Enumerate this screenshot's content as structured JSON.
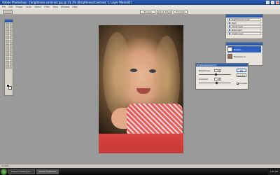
{
  "titlebar": {
    "title": "Adobe Photoshop - [brightness contrast.jpg @ 33.3% (Brightness/Contrast 1, Layer Mask/8)]"
  },
  "menu": [
    "File",
    "Edit",
    "Image",
    "Layer",
    "Select",
    "Filter",
    "View",
    "Window",
    "Help"
  ],
  "options": {
    "btn1": "Window",
    "btn2": "Actual Pixels",
    "btn3": "Print Size"
  },
  "history_panel": {
    "rows": [
      "Brightness/Contrast",
      "Open",
      "Adjust Layer",
      "Make Layer",
      "Create Layer",
      "Create Lay"
    ]
  },
  "layers_panel": {
    "rows": [
      {
        "label": "Brightn...",
        "selected": true
      },
      {
        "label": "Background",
        "selected": false
      }
    ]
  },
  "dialog": {
    "title": "Brightness/Contrast",
    "brightness_label": "Brightness:",
    "brightness_value": "+6",
    "contrast_label": "Contrast:",
    "contrast_value": "+8",
    "ok": "OK",
    "cancel": "Cancel",
    "preview": "Preview"
  },
  "status": "33.33%",
  "taskbar": {
    "items": [
      "Problem loading pa...",
      "Adobe Photoshop"
    ],
    "clock": "3:35 PM"
  }
}
